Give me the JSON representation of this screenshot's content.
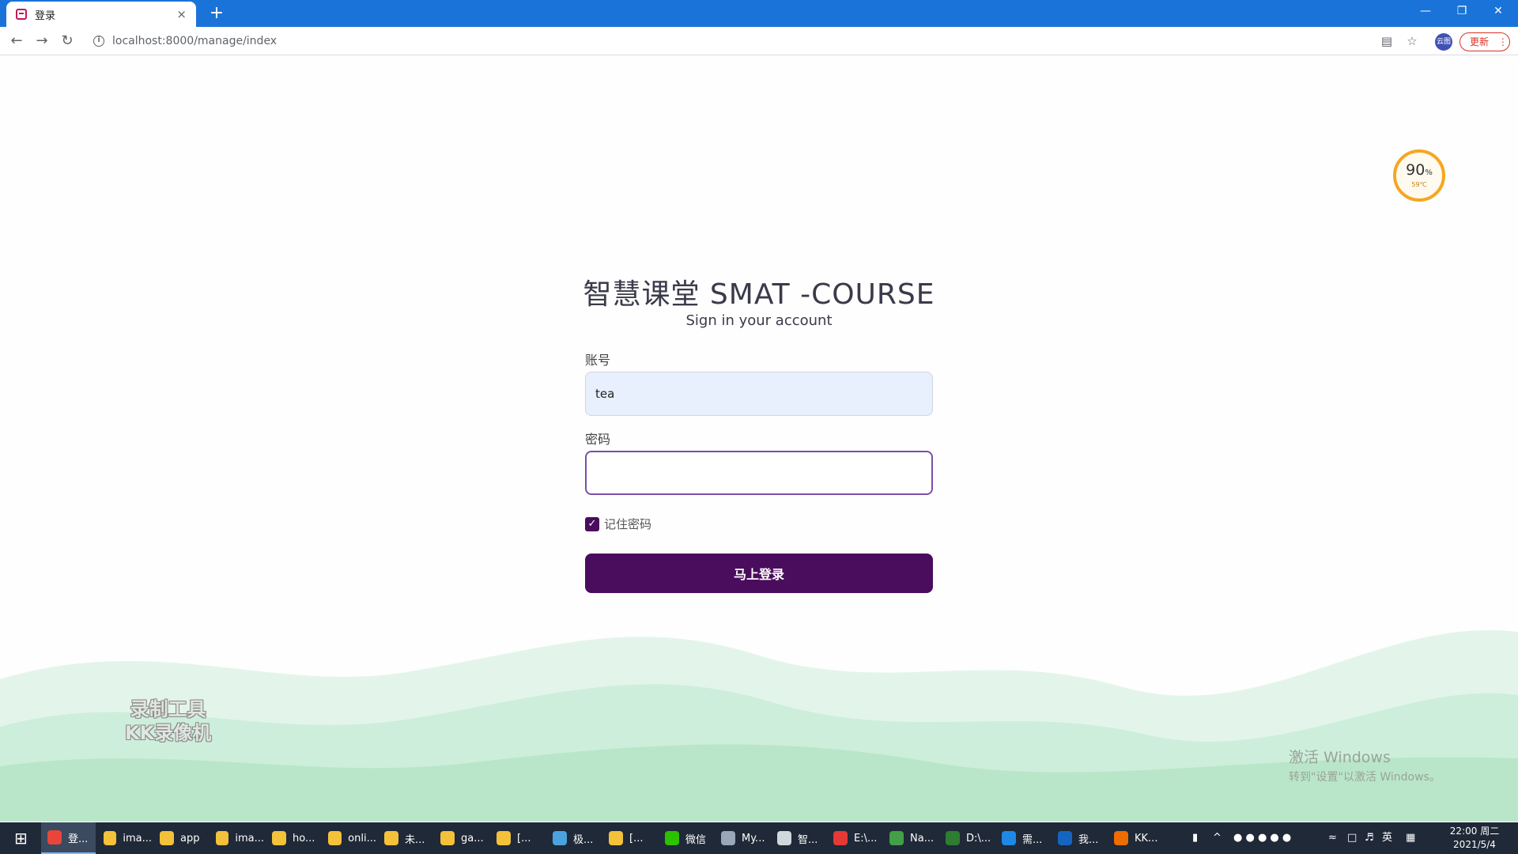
{
  "browser": {
    "tab_title": "登录",
    "tab_close": "×",
    "new_tab": "+",
    "url": "localhost:8000/manage/index",
    "update_label": "更新",
    "profile_label": "云图"
  },
  "temp_widget": {
    "percent": "90",
    "percent_unit": "%",
    "temperature": "59℃"
  },
  "login": {
    "title": "智慧课堂 SMAT -COURSE",
    "subtitle": "Sign in your account",
    "account_label": "账号",
    "account_value": "tea",
    "password_label": "密码",
    "password_value": "",
    "remember_label": "记住密码",
    "remember_checked": true,
    "submit_label": "马上登录"
  },
  "watermark": {
    "line1": "录制工具",
    "line2": "KK录像机"
  },
  "activation": {
    "line1": "激活 Windows",
    "line2": "转到\"设置\"以激活 Windows。"
  },
  "taskbar": {
    "items": [
      {
        "label": "登...",
        "color": "#e9453a"
      },
      {
        "label": "ima...",
        "color": "#f3c13a"
      },
      {
        "label": "app",
        "color": "#f3c13a"
      },
      {
        "label": "ima...",
        "color": "#f3c13a"
      },
      {
        "label": "ho...",
        "color": "#f3c13a"
      },
      {
        "label": "onli...",
        "color": "#f3c13a"
      },
      {
        "label": "未...",
        "color": "#f3c13a"
      },
      {
        "label": "ga...",
        "color": "#f3c13a"
      },
      {
        "label": "[...",
        "color": "#f3c13a"
      },
      {
        "label": "极...",
        "color": "#4aa3df"
      },
      {
        "label": "[...",
        "color": "#f3c13a"
      },
      {
        "label": "微信",
        "color": "#2dc100"
      },
      {
        "label": "My...",
        "color": "#9aa7b8"
      },
      {
        "label": "智...",
        "color": "#cfd8dc"
      },
      {
        "label": "E:\\...",
        "color": "#e53935"
      },
      {
        "label": "Na...",
        "color": "#43a047"
      },
      {
        "label": "D:\\...",
        "color": "#2e7d32"
      },
      {
        "label": "需...",
        "color": "#1e88e5"
      },
      {
        "label": "我...",
        "color": "#1565c0"
      },
      {
        "label": "KK...",
        "color": "#ef6c00"
      }
    ],
    "ime_label": "英",
    "time": "22:00 周二",
    "date": "2021/5/4"
  }
}
